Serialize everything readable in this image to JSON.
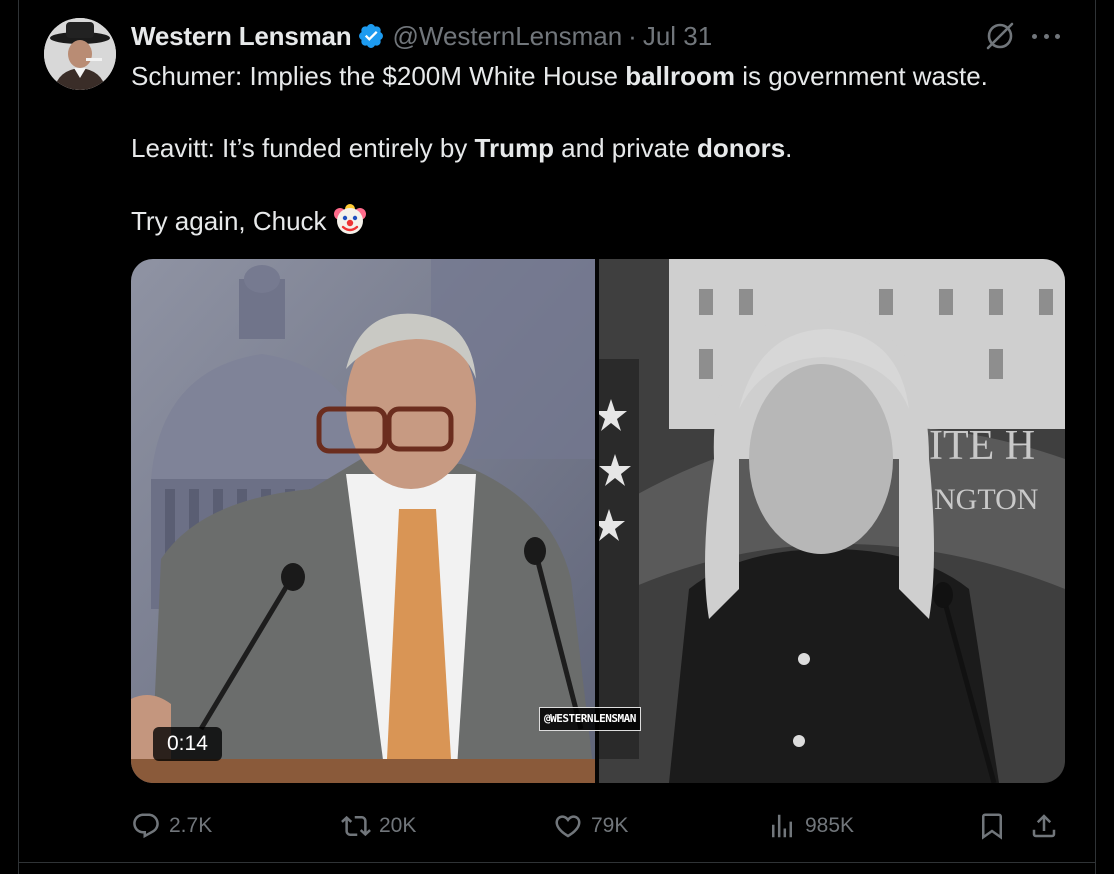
{
  "author": {
    "display_name": "Western Lensman",
    "handle": "@WesternLensman",
    "separator": "·",
    "date": "Jul 31",
    "verified": true,
    "verified_color": "#1d9bf0"
  },
  "tweet": {
    "line1": {
      "pre": "Schumer: Implies the $200M White House ",
      "b1": "ballroom",
      "post": " is government waste."
    },
    "line2": {
      "pre": "Leavitt: It’s funded entirely by ",
      "b1": "Trump",
      "mid": " and private ",
      "b2": "donors",
      "post": "."
    },
    "line3": {
      "text": "Try again, Chuck",
      "emoji": "clown-face-icon"
    }
  },
  "media": {
    "duration": "0:14",
    "watermark": "@WESTERNLENSMAN"
  },
  "actions": {
    "replies": "2.7K",
    "reposts": "20K",
    "likes": "79K",
    "views": "985K"
  },
  "icons": [
    "verified-badge-icon",
    "grok-icon",
    "more-icon",
    "reply-icon",
    "retweet-icon",
    "like-icon",
    "views-icon",
    "bookmark-icon",
    "share-icon"
  ],
  "colors": {
    "background": "#000000",
    "text": "#e7e9ea",
    "muted": "#71767b",
    "border": "#2f3336"
  }
}
